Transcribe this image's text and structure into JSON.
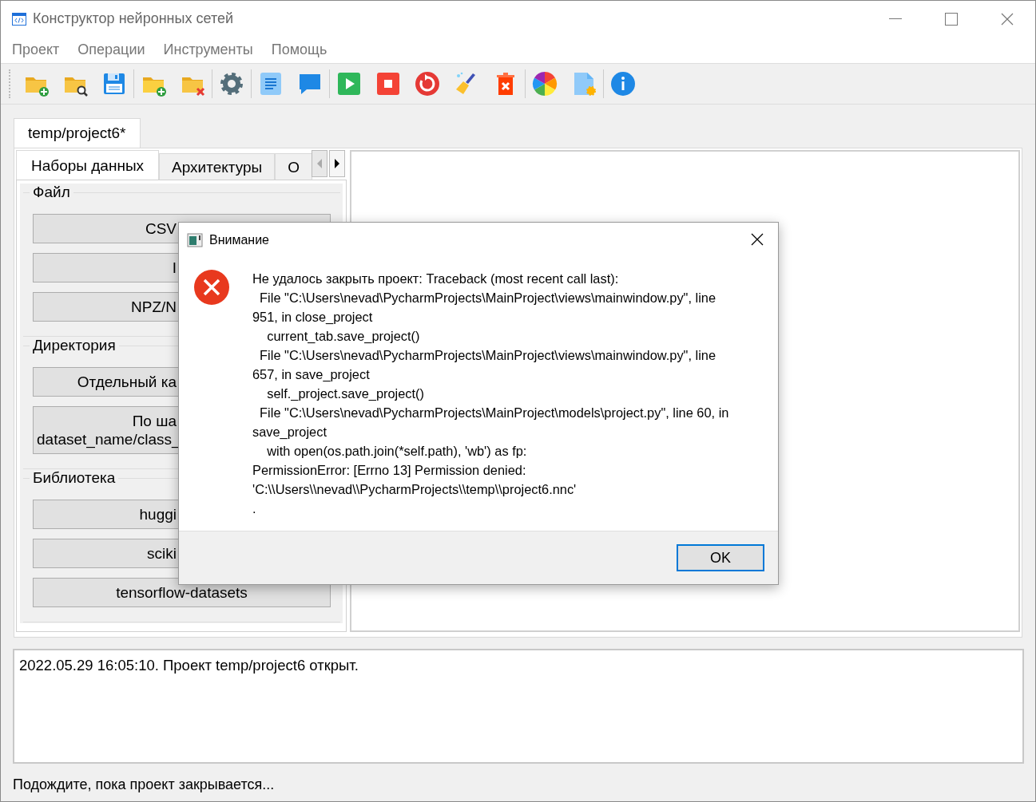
{
  "window": {
    "title": "Конструктор нейронных сетей"
  },
  "menu": [
    "Проект",
    "Операции",
    "Инструменты",
    "Помощь"
  ],
  "toolbar": [
    [
      {
        "kind": "folder-add"
      },
      {
        "kind": "folder-search"
      },
      {
        "kind": "save"
      }
    ],
    [
      {
        "kind": "folder-add-alt"
      },
      {
        "kind": "folder-remove"
      }
    ],
    [
      {
        "kind": "gear"
      }
    ],
    [
      {
        "kind": "document"
      },
      {
        "kind": "chat"
      }
    ],
    [
      {
        "kind": "play"
      },
      {
        "kind": "stop"
      },
      {
        "kind": "restart"
      },
      {
        "kind": "broom"
      },
      {
        "kind": "trash"
      }
    ],
    [
      {
        "kind": "color-wheel"
      },
      {
        "kind": "file-gear"
      }
    ],
    [
      {
        "kind": "info"
      }
    ]
  ],
  "project_tabs": [
    {
      "label": "temp/project6*",
      "selected": true
    }
  ],
  "tabs": [
    {
      "label": "Наборы данных",
      "selected": true
    },
    {
      "label": "Архитектуры",
      "selected": false
    },
    {
      "label": "О",
      "selected": false
    }
  ],
  "groups": [
    {
      "title": "Файл",
      "buttons": [
        "CSV",
        "I",
        "NPZ/N"
      ]
    },
    {
      "title": "Директория",
      "buttons": [
        "Отдельный ка",
        "По ша\ndataset_name/class_"
      ]
    },
    {
      "title": "Библиотека",
      "buttons": [
        "huggi",
        "sciki",
        "tensorflow-datasets"
      ]
    }
  ],
  "log": [
    "2022.05.29 16:05:10. Проект temp/project6 открыт."
  ],
  "status_bar": "Подождите, пока проект закрывается...",
  "dialog": {
    "title": "Внимание",
    "message": "Не удалось закрыть проект: Traceback (most recent call last):\n  File \"C:\\Users\\nevad\\PycharmProjects\\MainProject\\views\\mainwindow.py\", line 951, in close_project\n    current_tab.save_project()\n  File \"C:\\Users\\nevad\\PycharmProjects\\MainProject\\views\\mainwindow.py\", line 657, in save_project\n    self._project.save_project()\n  File \"C:\\Users\\nevad\\PycharmProjects\\MainProject\\models\\project.py\", line 60, in save_project\n    with open(os.path.join(*self.path), 'wb') as fp:\nPermissionError: [Errno 13] Permission denied: 'C:\\\\Users\\\\nevad\\\\PycharmProjects\\\\temp\\\\project6.nnc'\n.",
    "buttons": [
      "OK"
    ]
  }
}
